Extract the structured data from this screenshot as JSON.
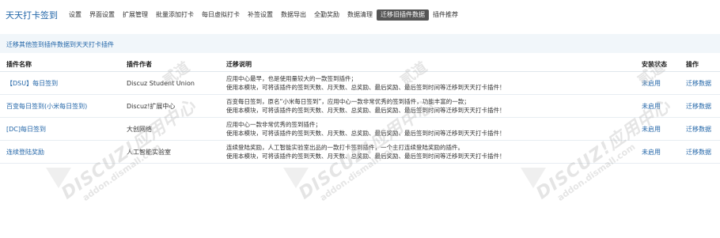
{
  "app": {
    "title": "天天打卡签到"
  },
  "nav": {
    "items": [
      {
        "label": "设置"
      },
      {
        "label": "界面设置"
      },
      {
        "label": "扩展管理"
      },
      {
        "label": "批量添加打卡"
      },
      {
        "label": "每日虚拟打卡"
      },
      {
        "label": "补签设置"
      },
      {
        "label": "数据导出"
      },
      {
        "label": "全勤奖励"
      },
      {
        "label": "数据清理"
      },
      {
        "label": "迁移旧插件数据",
        "active": true
      },
      {
        "label": "插件推荐"
      }
    ]
  },
  "section": {
    "title": "迁移其他签到插件数据到天天打卡插件"
  },
  "table": {
    "headers": {
      "name": "插件名称",
      "author": "插件作者",
      "desc": "迁移说明",
      "status": "安装状态",
      "action": "操作"
    },
    "rows": [
      {
        "name": "【DSU】每日签到",
        "author": "Discuz Student Union",
        "desc1": "应用中心最早，也是使用量较大的一款签到插件；",
        "desc2": "使用本模块，可将该插件的签到天数、月天数、总奖励、最后奖励、最后签到时间等迁移到天天打卡插件！",
        "status": "未启用",
        "action": "迁移数据"
      },
      {
        "name": "百变每日签到(小米每日签到)",
        "author": "Discuz!扩展中心",
        "desc1": "百变每日签到，原名“小米每日签到”，应用中心一款非常优秀的签到插件，功能丰富的一款；",
        "desc2": "使用本模块，可将该插件的签到天数、月天数、总奖励、最后奖励、最后签到时间等迁移到天天打卡插件！",
        "status": "未启用",
        "action": "迁移数据"
      },
      {
        "name": "[DC]每日签到",
        "author": "大创网络",
        "desc1": "应用中心一款非常优秀的签到插件；",
        "desc2": "使用本模块，可将该插件的签到天数、月天数、总奖励、最后奖励、最后签到时间等迁移到天天打卡插件！",
        "status": "未启用",
        "action": "迁移数据"
      },
      {
        "name": "连续登陆奖励",
        "author": "人工智能实验室",
        "desc1": "连续登陆奖励，人工智能实验室出品的一款打卡签到插件，一个主打连续登陆奖励的插件。",
        "desc2": "使用本模块，可将该插件的签到天数、月天数、总奖励、最后奖励、最后签到时间等迁移到天天打卡插件！",
        "status": "未启用",
        "action": "迁移数据"
      }
    ]
  },
  "watermark": {
    "logo": "DISCUZ!应用中心",
    "sub": "addon.dismall.com",
    "brand": "贰道"
  },
  "colors": {
    "link": "#2366a8",
    "active_tab_bg": "#555555",
    "section_bg": "#f1f6fa"
  }
}
